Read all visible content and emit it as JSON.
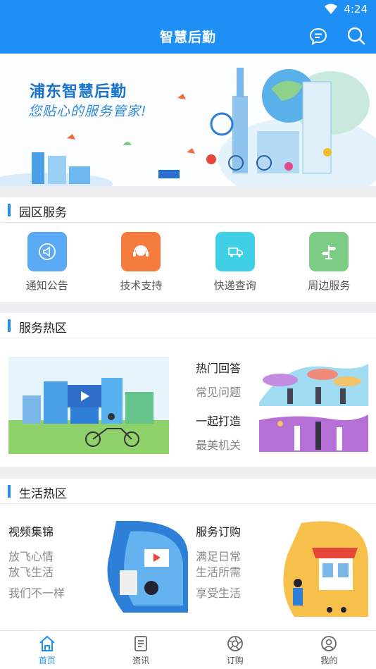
{
  "status_bar": {
    "time": "4:24"
  },
  "header": {
    "title": "智慧后勤"
  },
  "banner": {
    "headline": "浦东智慧后勤",
    "slogan": "您贴心的服务管家!"
  },
  "park_services": {
    "title": "园区服务",
    "items": [
      {
        "label": "通知公告",
        "icon": "megaphone-icon",
        "color": "#5aaaf5"
      },
      {
        "label": "技术支持",
        "icon": "headset-icon",
        "color": "#f57c3f"
      },
      {
        "label": "快递查询",
        "icon": "truck-icon",
        "color": "#3fd0e6"
      },
      {
        "label": "周边服务",
        "icon": "signpost-icon",
        "color": "#7ccc84"
      }
    ]
  },
  "service_hot": {
    "title": "服务热区",
    "items": [
      {
        "title": "热门回答",
        "subtitle": "常见问题"
      },
      {
        "title": "一起打造",
        "subtitle": "最美机关"
      }
    ]
  },
  "life_hot": {
    "title": "生活热区",
    "left": {
      "title": "视频集锦",
      "line1": "放飞心情",
      "line2": "放飞生活",
      "line3": "我们不一样"
    },
    "right": {
      "title": "服务订购",
      "line1": "满足日常",
      "line2": "生活所需",
      "line3": "享受生活"
    }
  },
  "tabs": [
    {
      "label": "首页",
      "icon": "home-icon",
      "active": true
    },
    {
      "label": "资讯",
      "icon": "news-icon",
      "active": false
    },
    {
      "label": "订购",
      "icon": "aperture-icon",
      "active": false
    },
    {
      "label": "我的",
      "icon": "profile-icon",
      "active": false
    }
  ],
  "colors": {
    "primary": "#1e90f5",
    "background": "#f0f0f3"
  }
}
